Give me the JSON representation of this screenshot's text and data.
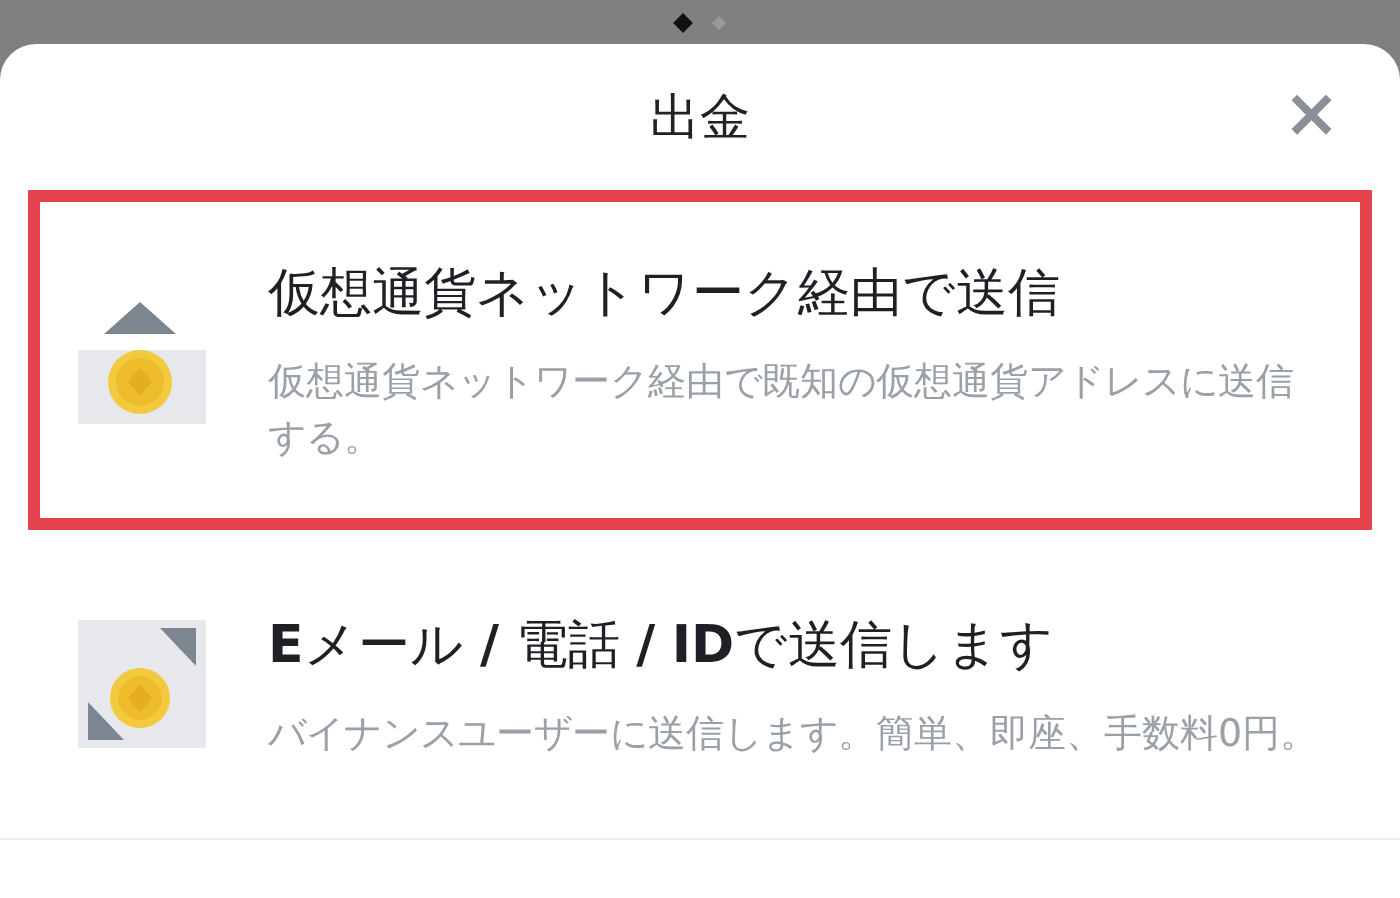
{
  "pager": [
    {
      "selected": true
    },
    {
      "selected": false
    }
  ],
  "sheet": {
    "title": "出金",
    "close": "×"
  },
  "options": [
    {
      "kind": "network",
      "selected": true,
      "title": "仮想通貨ネットワーク経由で送信",
      "description": "仮想通貨ネットワーク経由で既知の仮想通貨アドレスに送信する。"
    },
    {
      "kind": "internal",
      "selected": false,
      "title": "**E**メール **/** 電話 **/** **ID**で送信します",
      "description": "バイナンスユーザーに送信します。簡単、即座、手数料0円。"
    }
  ]
}
